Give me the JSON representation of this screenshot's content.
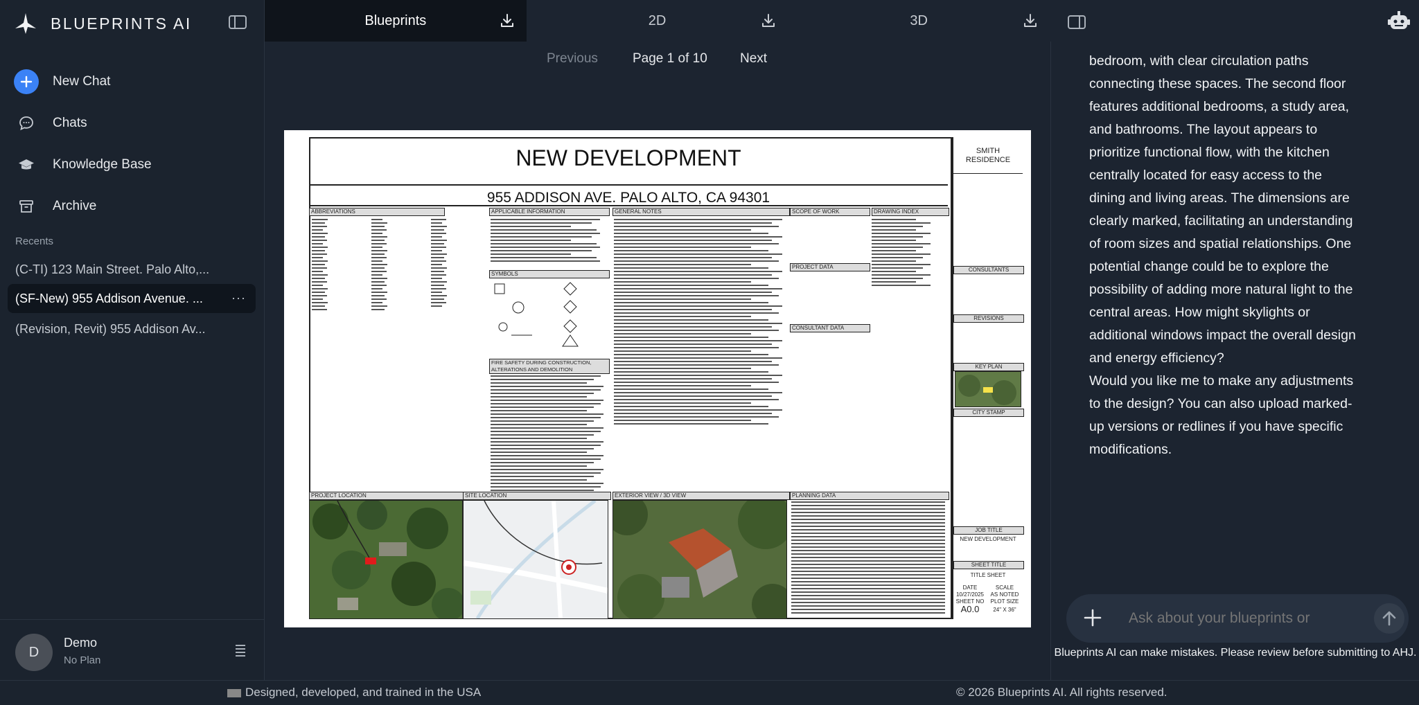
{
  "app": {
    "brand": "BLUEPRINTS AI"
  },
  "sidebar": {
    "nav": [
      {
        "label": "New Chat",
        "icon": "plus-circle-icon"
      },
      {
        "label": "Chats",
        "icon": "chat-bubble-icon"
      },
      {
        "label": "Knowledge Base",
        "icon": "graduation-cap-icon"
      },
      {
        "label": "Archive",
        "icon": "archive-box-icon"
      }
    ],
    "recents_label": "Recents",
    "recents": [
      {
        "label": "(C-TI) 123 Main Street. Palo Alto,..."
      },
      {
        "label": "(SF-New) 955 Addison Avenue. ...",
        "more": "···"
      },
      {
        "label": "(Revision, Revit) 955 Addison Av..."
      }
    ],
    "user": {
      "initial": "D",
      "name": "Demo",
      "plan": "No Plan"
    }
  },
  "tabs": [
    {
      "label": "Blueprints",
      "active": true
    },
    {
      "label": "2D",
      "active": false
    },
    {
      "label": "3D",
      "active": false
    }
  ],
  "pager": {
    "previous": "Previous",
    "page": "Page 1 of 10",
    "next": "Next"
  },
  "sheet": {
    "title": "NEW DEVELOPMENT",
    "address": "955 ADDISON AVE. PALO ALTO, CA 94301",
    "client": "SMITH RESIDENCE",
    "sections": {
      "abbreviations": "ABBREVIATIONS",
      "applicable": "APPLICABLE INFORMATION",
      "general": "GENERAL NOTES",
      "scope": "SCOPE OF WORK",
      "index": "DRAWING INDEX",
      "symbols": "SYMBOLS",
      "project_data": "PROJECT DATA",
      "consultant": "CONSULTANT DATA",
      "fire": "FIRE SAFETY DURING CONSTRUCTION, ALTERATIONS AND DEMOLITION",
      "project_location": "PROJECT LOCATION",
      "site_location": "SITE LOCATION",
      "exterior": "EXTERIOR VIEW / 3D VIEW",
      "planning": "PLANNING DATA"
    },
    "title_block": {
      "consultants": "CONSULTANTS",
      "revisions": "REVISIONS",
      "key_plan": "KEY PLAN",
      "city_stamp": "CITY STAMP",
      "job_title_label": "JOB TITLE",
      "job_title": "NEW DEVELOPMENT",
      "sheet_title_label": "SHEET TITLE",
      "sheet_title": "TITLE SHEET",
      "date_label": "DATE",
      "date": "10/27/2025",
      "scale_label": "SCALE",
      "scale": "AS NOTED",
      "sheet_no_label": "SHEET NO",
      "sheet_no": "A0.0",
      "plot_size_label": "PLOT SIZE",
      "plot_size": "24\" X 36\""
    }
  },
  "chat": {
    "message_p1": "bedroom, with clear circulation paths connecting these spaces. The second floor features additional bedrooms, a study area, and bathrooms. The layout appears to prioritize functional flow, with the kitchen centrally located for easy access to the dining and living areas. The dimensions are clearly marked, facilitating an understanding of room sizes and spatial relationships. One potential change could be to explore the possibility of adding more natural light to the central areas. How might skylights or additional windows impact the overall design and energy efficiency?",
    "message_p2": "Would you like me to make any adjustments to the design? You can also upload marked-up versions or redlines if you have specific modifications.",
    "input_placeholder": "Ask about your blueprints or",
    "disclaimer": "Blueprints AI can make mistakes. Please review before submitting to AHJ."
  },
  "footer": {
    "left": "Designed, developed, and trained in the USA",
    "right": "© 2026 Blueprints AI. All rights reserved."
  },
  "colors": {
    "accent": "#3b82f6",
    "background": "#1c2430",
    "sidebar": "#1b232e",
    "active_tab": "#0f141b"
  }
}
